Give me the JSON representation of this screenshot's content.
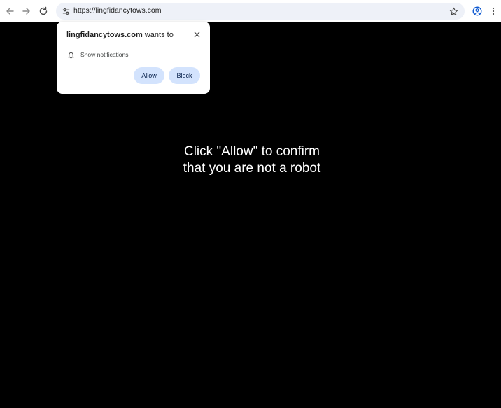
{
  "browser": {
    "url": "https://lingfidancytows.com",
    "icons": {
      "back": "arrow-left-icon",
      "forward": "arrow-right-icon",
      "reload": "reload-icon",
      "site_info": "tune-icon",
      "bookmark": "star-icon",
      "profile": "account-circle-icon",
      "menu": "more-vert-icon"
    }
  },
  "permission_popup": {
    "host": "lingfidancytows.com",
    "wants_to": " wants to",
    "permission_label": "Show notifications",
    "allow_label": "Allow",
    "block_label": "Block",
    "icons": {
      "close": "close-icon",
      "permission": "bell-icon"
    }
  },
  "page": {
    "message_line1": "Click \"Allow\" to confirm",
    "message_line2": "that you are not a robot"
  },
  "colors": {
    "page_background": "#000000",
    "button_fill": "#d3e3fd",
    "button_text": "#041e49",
    "omnibox": "#eef1f8"
  }
}
